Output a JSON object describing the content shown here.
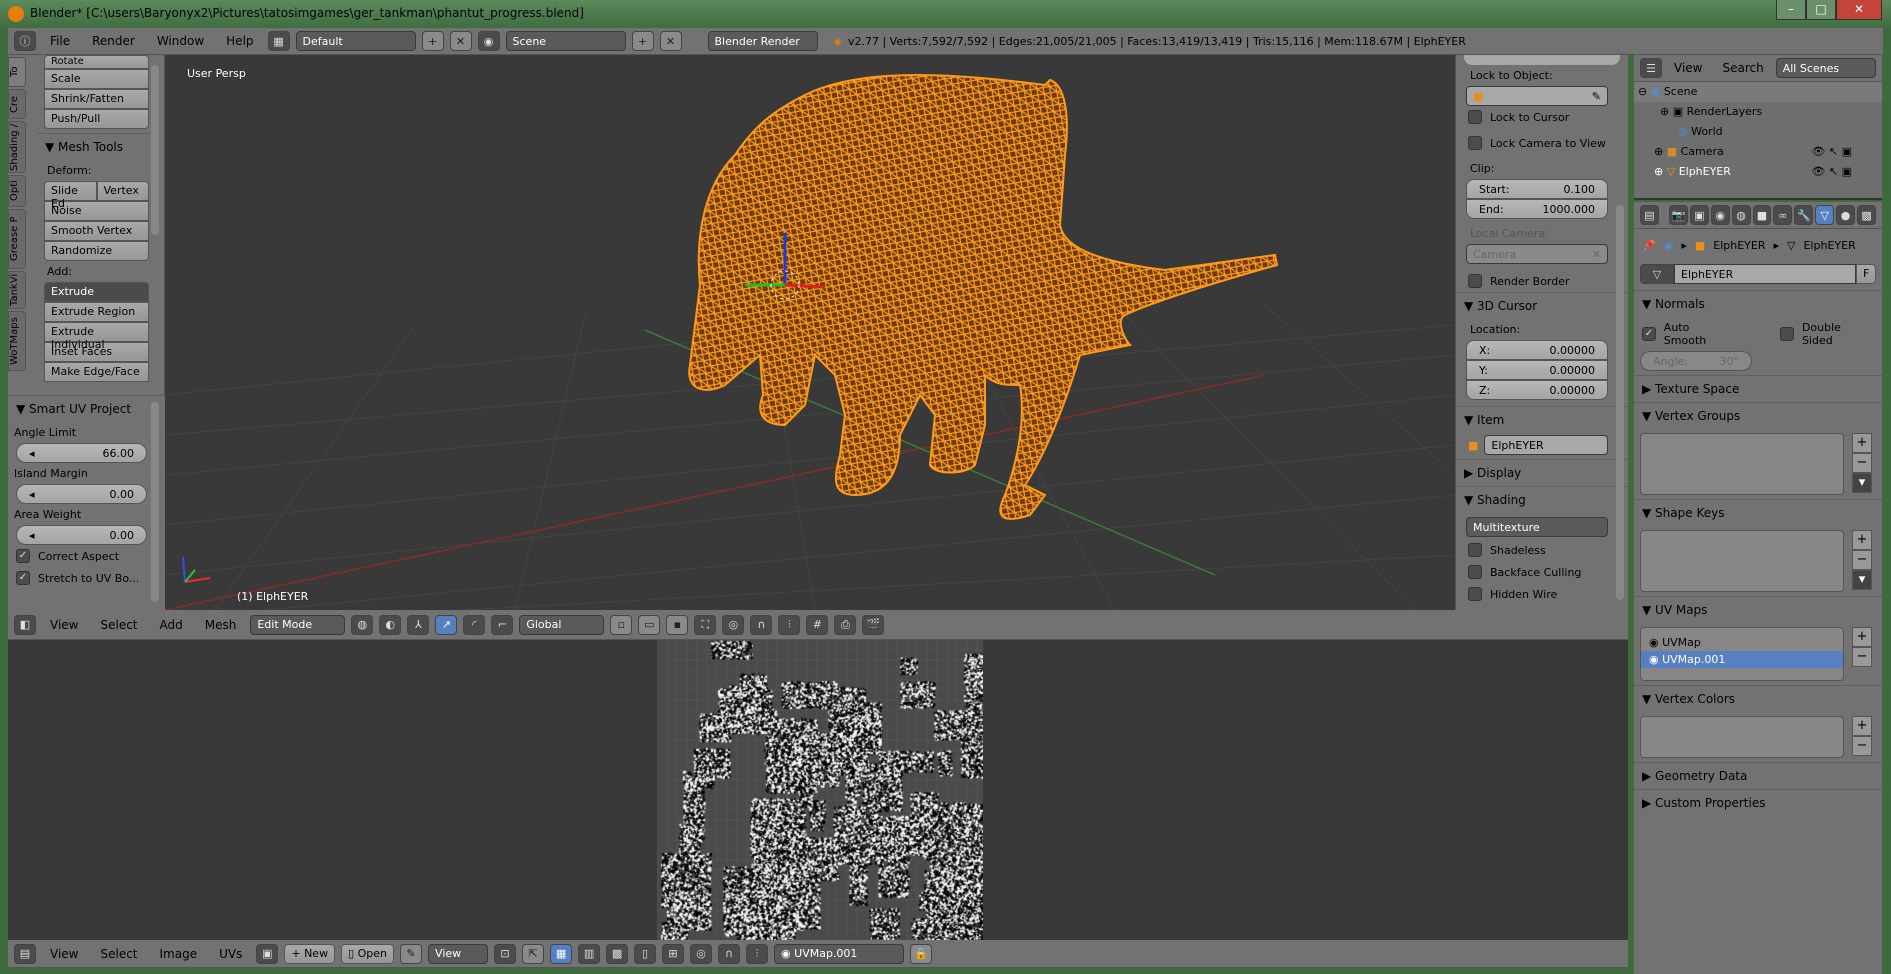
{
  "window": {
    "title": "Blender* [C:\\users\\Baryonyx2\\Pictures\\tatosimgames\\ger_tankman\\phantut_progress.blend]",
    "minimize": "–",
    "maximize": "□",
    "close": "✕"
  },
  "topbar": {
    "menus": [
      "File",
      "Render",
      "Window",
      "Help"
    ],
    "layout": "Default",
    "scene": "Scene",
    "engine": "Blender Render",
    "stats": "v2.77 | Verts:7,592/7,592 | Edges:21,005/21,005 | Faces:13,419/13,419 | Tris:15,116 | Mem:118.67M | ElphEYER"
  },
  "toolshelf": {
    "tabs": [
      "To",
      "Cre",
      "Shading /",
      "Opti",
      "Grease P",
      "TankVi",
      "WoTMaps"
    ],
    "transform": [
      "Rotate",
      "Scale",
      "Shrink/Fatten",
      "Push/Pull"
    ],
    "mesh_tools_title": "Mesh Tools",
    "deform_label": "Deform:",
    "deform_row": [
      "Slide Ed",
      "Vertex"
    ],
    "deform": [
      "Noise",
      "Smooth Vertex",
      "Randomize"
    ],
    "add_label": "Add:",
    "add_dropdown": "Extrude",
    "add": [
      "Extrude Region",
      "Extrude Individual",
      "Inset Faces",
      "Make Edge/Face"
    ]
  },
  "operator": {
    "title": "Smart UV Project",
    "angle_limit_label": "Angle Limit",
    "angle_limit": "66.00",
    "island_margin_label": "Island Margin",
    "island_margin": "0.00",
    "area_weight_label": "Area Weight",
    "area_weight": "0.00",
    "correct_aspect": "Correct Aspect",
    "correct_aspect_checked": true,
    "stretch": "Stretch to UV Bo...",
    "stretch_checked": true
  },
  "viewport": {
    "view_label": "User Persp",
    "object_label": "(1) ElphEYER",
    "mesh_color": "#ff9a1a"
  },
  "viewport_header": {
    "menus": [
      "View",
      "Select",
      "Add",
      "Mesh"
    ],
    "mode": "Edit Mode",
    "orientation": "Global"
  },
  "npanel": {
    "lock_to_object": "Lock to Object:",
    "lock_to_cursor": "Lock to Cursor",
    "lock_camera": "Lock Camera to View",
    "clip": "Clip:",
    "start_label": "Start:",
    "start": "0.100",
    "end_label": "End:",
    "end": "1000.000",
    "local_camera": "Local Camera:",
    "camera": "Camera",
    "render_border": "Render Border",
    "cursor_title": "3D Cursor",
    "location": "Location:",
    "x_label": "X:",
    "x": "0.00000",
    "y_label": "Y:",
    "y": "0.00000",
    "z_label": "Z:",
    "z": "0.00000",
    "item_title": "Item",
    "item_name": "ElphEYER",
    "display_title": "Display",
    "shading_title": "Shading",
    "shading_mode": "Multitexture",
    "shadeless": "Shadeless",
    "backface": "Backface Culling",
    "hidden_wire": "Hidden Wire"
  },
  "outliner": {
    "menus": [
      "View",
      "Search"
    ],
    "filter": "All Scenes",
    "items": [
      {
        "name": "Scene"
      },
      {
        "name": "RenderLayers"
      },
      {
        "name": "World"
      },
      {
        "name": "Camera"
      },
      {
        "name": "ElphEYER"
      }
    ]
  },
  "properties": {
    "breadcrumb": [
      "ElphEYER",
      "ElphEYER"
    ],
    "mesh_name": "ElphEYER",
    "fake_user": "F",
    "normals_title": "Normals",
    "auto_smooth": "Auto Smooth",
    "auto_smooth_checked": true,
    "double_sided": "Double Sided",
    "angle_label": "Angle:",
    "angle": "30°",
    "texture_space": "Texture Space",
    "vertex_groups": "Vertex Groups",
    "shape_keys": "Shape Keys",
    "uv_maps": "UV Maps",
    "uv_list": [
      "UVMap",
      "UVMap.001"
    ],
    "uv_selected": 1,
    "vertex_colors": "Vertex Colors",
    "geometry_data": "Geometry Data",
    "custom_properties": "Custom Properties"
  },
  "uv_header": {
    "menus": [
      "View",
      "Select",
      "Image",
      "UVs"
    ],
    "new": "New",
    "open": "Open",
    "view": "View",
    "uvmap": "UVMap.001"
  }
}
